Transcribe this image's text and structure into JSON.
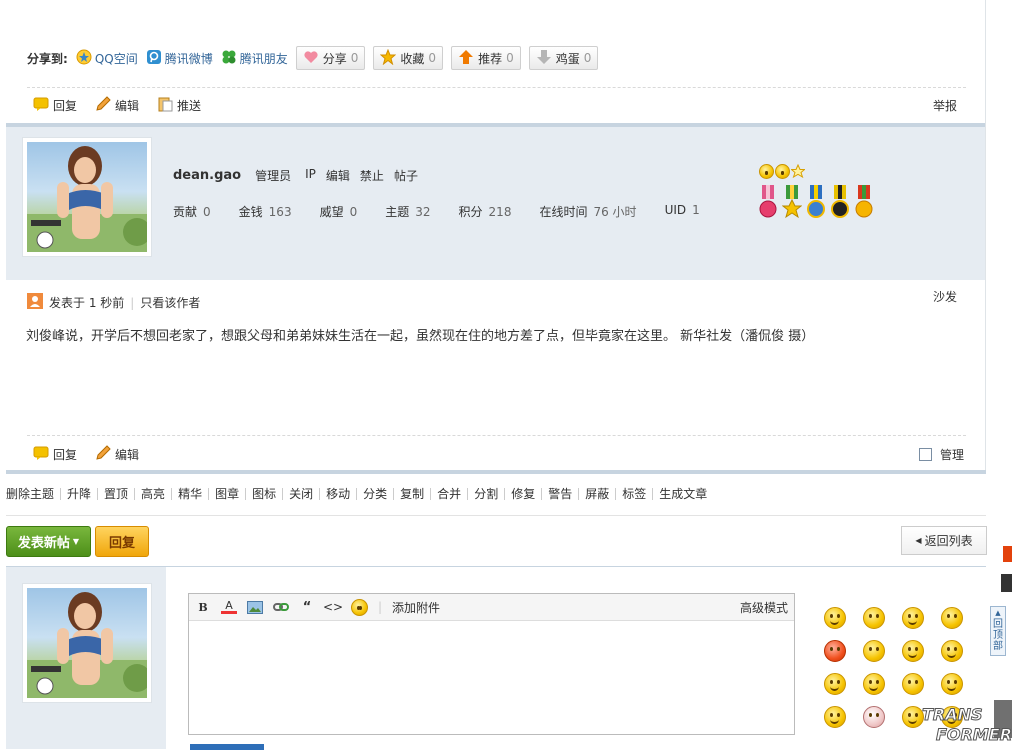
{
  "share": {
    "label": "分享到:",
    "links": [
      {
        "icon": "qzone-star-icon",
        "label": "QQ空间"
      },
      {
        "icon": "tencent-weibo-icon",
        "label": "腾讯微博"
      },
      {
        "icon": "clover-icon",
        "label": "腾讯朋友"
      }
    ],
    "buttons": [
      {
        "icon": "heart-icon",
        "label": "分享",
        "count": "0"
      },
      {
        "icon": "star-icon",
        "label": "收藏",
        "count": "0"
      },
      {
        "icon": "arrow-up-icon",
        "label": "推荐",
        "count": "0"
      },
      {
        "icon": "arrow-down-icon",
        "label": "鸡蛋",
        "count": "0"
      }
    ]
  },
  "post1_actions": {
    "reply": "回复",
    "edit": "编辑",
    "push": "推送",
    "report": "举报"
  },
  "profile": {
    "username": "dean.gao",
    "group": "管理员",
    "links": [
      "IP",
      "编辑",
      "禁止",
      "帖子"
    ],
    "stats": [
      {
        "label": "贡献",
        "value": "0"
      },
      {
        "label": "金钱",
        "value": "163"
      },
      {
        "label": "威望",
        "value": "0"
      },
      {
        "label": "主题",
        "value": "32"
      },
      {
        "label": "积分",
        "value": "218"
      },
      {
        "label": "在线时间",
        "value": "76 小时"
      },
      {
        "label": "UID",
        "value": "1"
      }
    ]
  },
  "post2": {
    "posted": "发表于 1 秒前",
    "only_author": "只看该作者",
    "floor": "沙发",
    "content": "刘俊峰说，开学后不想回老家了，想跟父母和弟弟妹妹生活在一起，虽然现在住的地方差了点，但毕竟家在这里。 新华社发（潘侃俊 摄）",
    "reply": "回复",
    "edit": "编辑",
    "manage": "管理"
  },
  "mod_toolbar": [
    "删除主题",
    "升降",
    "置顶",
    "高亮",
    "精华",
    "图章",
    "图标",
    "关闭",
    "移动",
    "分类",
    "复制",
    "合并",
    "分割",
    "修复",
    "警告",
    "屏蔽",
    "标签",
    "生成文章"
  ],
  "buttons": {
    "new_post": "发表新帖",
    "reply": "回复",
    "back_to_list": "返回列表"
  },
  "editor": {
    "attach": "添加附件",
    "advanced": "高级模式"
  },
  "side_float": {
    "back_to_top": "回顶部"
  },
  "watermark": "TRANS FORMER",
  "colors": {
    "link_blue": "#336699",
    "profile_bg": "#e6ecf2",
    "green_button": "#4d8f19",
    "yellow_button": "#f0a60b"
  }
}
